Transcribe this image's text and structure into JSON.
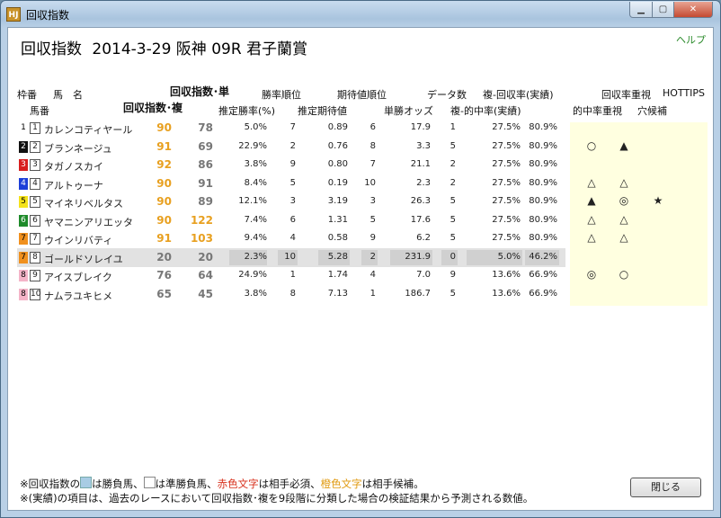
{
  "window": {
    "title": "回収指数",
    "icon_text": "HJ"
  },
  "header": {
    "title": "回収指数",
    "date": "2014-3-29",
    "venue": "阪神",
    "race": "09R",
    "race_name": "君子蘭賞",
    "help": "ヘルプ"
  },
  "columns": {
    "waku": "枠番",
    "horse_name": "馬　名",
    "umaban": "馬番",
    "index_win": "回収指数･単",
    "index_place": "回収指数･複",
    "win_rate_rank": "勝率順位",
    "est_win_rate": "推定勝率(%)",
    "ev_rank": "期待値順位",
    "est_ev": "推定期待値",
    "win_odds": "単勝オッズ",
    "data_count": "データ数",
    "hit_rate": "複-的中率(実績)",
    "return_rate": "複-回収率(実績)",
    "return_focus": "回収率重視",
    "hit_focus": "的中率重視",
    "hottips": "HOTTIPS",
    "dark_horse": "穴候補"
  },
  "rows": [
    {
      "waku": "1",
      "num": "1",
      "name": "カレンコティヤール",
      "iw": "90",
      "ip": "78",
      "wr": "5.0%",
      "wrr": "7",
      "ev": "0.89",
      "evr": "6",
      "odds": "17.9",
      "cnt": "1",
      "hit": "27.5%",
      "ret": "80.9%",
      "wcolor": "#ffffff",
      "wtext": "#000",
      "ip_orange": false,
      "mark_ret": "",
      "mark_hit": "",
      "mark_hot": "",
      "hl": false
    },
    {
      "waku": "2",
      "num": "2",
      "name": "ブランネージュ",
      "iw": "91",
      "ip": "69",
      "wr": "22.9%",
      "wrr": "2",
      "ev": "0.76",
      "evr": "8",
      "odds": "3.3",
      "cnt": "5",
      "hit": "27.5%",
      "ret": "80.9%",
      "wcolor": "#111111",
      "wtext": "#fff",
      "ip_orange": false,
      "mark_ret": "○",
      "mark_hit": "▲",
      "mark_hot": "",
      "hl": false
    },
    {
      "waku": "3",
      "num": "3",
      "name": "タガノスカイ",
      "iw": "92",
      "ip": "86",
      "wr": "3.8%",
      "wrr": "9",
      "ev": "0.80",
      "evr": "7",
      "odds": "21.1",
      "cnt": "2",
      "hit": "27.5%",
      "ret": "80.9%",
      "wcolor": "#d81e1e",
      "wtext": "#fff",
      "ip_orange": false,
      "mark_ret": "",
      "mark_hit": "",
      "mark_hot": "",
      "hl": false
    },
    {
      "waku": "4",
      "num": "4",
      "name": "アルトゥーナ",
      "iw": "90",
      "ip": "91",
      "wr": "8.4%",
      "wrr": "5",
      "ev": "0.19",
      "evr": "10",
      "odds": "2.3",
      "cnt": "2",
      "hit": "27.5%",
      "ret": "80.9%",
      "wcolor": "#1c3ed8",
      "wtext": "#fff",
      "ip_orange": false,
      "mark_ret": "△",
      "mark_hit": "△",
      "mark_hot": "",
      "hl": false
    },
    {
      "waku": "5",
      "num": "5",
      "name": "マイネリベルタス",
      "iw": "90",
      "ip": "89",
      "wr": "12.1%",
      "wrr": "3",
      "ev": "3.19",
      "evr": "3",
      "odds": "26.3",
      "cnt": "5",
      "hit": "27.5%",
      "ret": "80.9%",
      "wcolor": "#f4e21a",
      "wtext": "#000",
      "ip_orange": false,
      "mark_ret": "▲",
      "mark_hit": "◎",
      "mark_hot": "★",
      "hl": false
    },
    {
      "waku": "6",
      "num": "6",
      "name": "ヤマニンアリエッタ",
      "iw": "90",
      "ip": "122",
      "wr": "7.4%",
      "wrr": "6",
      "ev": "1.31",
      "evr": "5",
      "odds": "17.6",
      "cnt": "5",
      "hit": "27.5%",
      "ret": "80.9%",
      "wcolor": "#1e8a2a",
      "wtext": "#fff",
      "ip_orange": true,
      "mark_ret": "△",
      "mark_hit": "△",
      "mark_hot": "",
      "hl": false
    },
    {
      "waku": "7",
      "num": "7",
      "name": "ウインリバティ",
      "iw": "91",
      "ip": "103",
      "wr": "9.4%",
      "wrr": "4",
      "ev": "0.58",
      "evr": "9",
      "odds": "6.2",
      "cnt": "5",
      "hit": "27.5%",
      "ret": "80.9%",
      "wcolor": "#f0901e",
      "wtext": "#000",
      "ip_orange": true,
      "mark_ret": "△",
      "mark_hit": "△",
      "mark_hot": "",
      "hl": false
    },
    {
      "waku": "7",
      "num": "8",
      "name": "ゴールドソレイユ",
      "iw": "20",
      "ip": "20",
      "wr": "2.3%",
      "wrr": "10",
      "ev": "5.28",
      "evr": "2",
      "odds": "231.9",
      "cnt": "0",
      "hit": "5.0%",
      "ret": "46.2%",
      "wcolor": "#f0901e",
      "wtext": "#000",
      "ip_orange": false,
      "mark_ret": "",
      "mark_hit": "",
      "mark_hot": "",
      "hl": true
    },
    {
      "waku": "8",
      "num": "9",
      "name": "アイスブレイク",
      "iw": "76",
      "ip": "64",
      "wr": "24.9%",
      "wrr": "1",
      "ev": "1.74",
      "evr": "4",
      "odds": "7.0",
      "cnt": "9",
      "hit": "13.6%",
      "ret": "66.9%",
      "wcolor": "#f4b4c8",
      "wtext": "#000",
      "ip_orange": false,
      "mark_ret": "◎",
      "mark_hit": "○",
      "mark_hot": "",
      "hl": false
    },
    {
      "waku": "8",
      "num": "10",
      "name": "ナムラユキヒメ",
      "iw": "65",
      "ip": "45",
      "wr": "3.8%",
      "wrr": "8",
      "ev": "7.13",
      "evr": "1",
      "odds": "186.7",
      "cnt": "5",
      "hit": "13.6%",
      "ret": "66.9%",
      "wcolor": "#f4b4c8",
      "wtext": "#000",
      "ip_orange": false,
      "mark_ret": "",
      "mark_hit": "",
      "mark_hot": "",
      "hl": false
    }
  ],
  "footer": {
    "line1_a": "※回収指数の",
    "line1_b": "は勝負馬、",
    "line1_c": "は準勝負馬、",
    "line1_red": "赤色文字",
    "line1_d": "は相手必須、",
    "line1_orange": "橙色文字",
    "line1_e": "は相手候補。",
    "line2": "※(実績)の項目は、過去のレースにおいて回収指数･複を9段階に分類した場合の検証結果から予測される数値。"
  },
  "close_button": "閉じる",
  "colors": {
    "orange": "#e8a020",
    "red": "#d8321e",
    "highlight": "#a8cce4",
    "marks_bg": "#ffffe0"
  }
}
